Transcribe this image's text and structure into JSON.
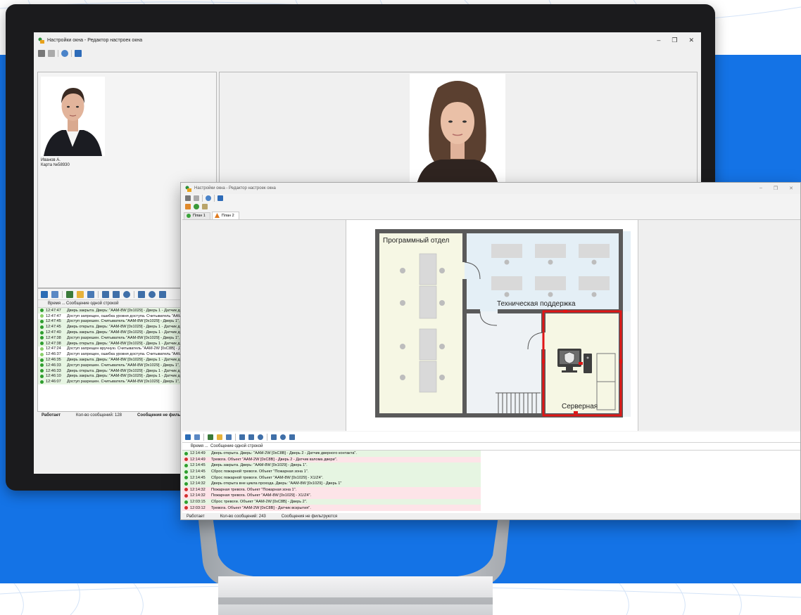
{
  "app": {
    "window_title": "Настройки окна - Редактор настроек окна",
    "minimize": "–",
    "restore": "❐",
    "close": "✕"
  },
  "person_left": {
    "name": "Иванов А.",
    "card": "Карта №58930"
  },
  "back_log": {
    "col_time": "Время ...",
    "col_message": "Сообщение одной строкой",
    "rows": [
      {
        "time": "12:47:47",
        "text": "Дверь закрыта. Дверь: \"AAM-8W [0x1029] - Дверь 1 - Датчик две",
        "status": "green"
      },
      {
        "time": "12:47:47",
        "text": "Доступ запрещен, ошибка уровня доступа. Считыватель \"AAM",
        "status": "light"
      },
      {
        "time": "12:47:45",
        "text": "Доступ разрешен. Считыватель \"AAM-8W [0x1029] - Дверь 1\", к",
        "status": "green"
      },
      {
        "time": "12:47:45",
        "text": "Дверь открыта. Дверь: \"AAM-8W [0x1029] - Дверь 1 - Датчик две",
        "status": "green"
      },
      {
        "time": "12:47:40",
        "text": "Дверь закрыта. Дверь: \"AAM-8W [0x1029] - Дверь 1 - Датчик две",
        "status": "green"
      },
      {
        "time": "12:47:38",
        "text": "Доступ разрешен. Считыватель \"AAM-8W [0x1029] - Дверь 1\", к",
        "status": "green"
      },
      {
        "time": "12:47:38",
        "text": "Дверь открыта. Дверь: \"AAM-8W [0x1029] - Дверь 1 - Датчик две",
        "status": "green"
      },
      {
        "time": "12:47:24",
        "text": "Доступ запрещен вручную. Считыватель \"AAM-2W [0xC8B] - Д",
        "status": "light"
      },
      {
        "time": "12:46:37",
        "text": "Доступ запрещен, ошибка уровня доступа. Считыватель \"AAM",
        "status": "light"
      },
      {
        "time": "12:46:35",
        "text": "Дверь закрыта. Дверь: \"AAM-8W [0x1029] - Дверь 1 - Датчик две",
        "status": "green"
      },
      {
        "time": "12:46:33",
        "text": "Доступ разрешен. Считыватель \"AAM-8W [0x1029] - Дверь 1\", к",
        "status": "green"
      },
      {
        "time": "12:46:33",
        "text": "Дверь открыта. Дверь: \"AAM-8W [0x1029] - Дверь 1 - Датчик две",
        "status": "green"
      },
      {
        "time": "12:46:10",
        "text": "Дверь закрыта. Дверь: \"AAM-8W [0x1029] - Дверь 1 - Датчик две",
        "status": "green"
      },
      {
        "time": "12:46:07",
        "text": "Доступ разрешен. Считыватель \"AAM-8W [0x1029] - Дверь 1\", к",
        "status": "green"
      }
    ],
    "status_working": "Работает",
    "status_count": "Кол-во сообщений: 128",
    "status_filter": "Сообщения не фильтруются"
  },
  "front": {
    "tabs": [
      "План 1",
      "План 2"
    ],
    "rooms": {
      "dev": "Программный отдел",
      "support": "Техническая поддержка",
      "server": "Серверная"
    },
    "log": {
      "col_time": "Время ...",
      "col_message": "Сообщение одной строкой",
      "rows": [
        {
          "time": "12:14:49",
          "text": "Дверь открыта. Дверь: \"AAM-2W [0xC8B] - Дверь 2 - Датчик дверного контакта\".",
          "status": "green"
        },
        {
          "time": "12:14:49",
          "text": "Тревога. Объект \"AAM-2W [0xC8B] - Дверь 2 - Датчик взлома двери\".",
          "status": "red"
        },
        {
          "time": "12:14:45",
          "text": "Дверь закрыта. Дверь: \"AAM-8W [0x1029] - Дверь 1\".",
          "status": "green"
        },
        {
          "time": "12:14:45",
          "text": "Сброс пожарной тревоги. Объект \"Пожарная зона 1\".",
          "status": "green"
        },
        {
          "time": "12:14:45",
          "text": "Сброс пожарной тревоги. Объект \"AAM-8W [0x1029] - X1/Z4\".",
          "status": "green"
        },
        {
          "time": "12:14:32",
          "text": "Дверь открыта вне цикла прохода. Дверь: \"AAM-8W [0x1029] - Дверь 1\"",
          "status": "green"
        },
        {
          "time": "12:14:32",
          "text": "Пожарная тревога. Объект \"Пожарная зона 1\".",
          "status": "red"
        },
        {
          "time": "12:14:32",
          "text": "Пожарная тревога. Объект \"AAM-8W [0x1029] - X1/Z4\".",
          "status": "red"
        },
        {
          "time": "12:03:15",
          "text": "Сброс тревоги. Объект \"AAM-2W [0xC8B] - Дверь 2\".",
          "status": "green"
        },
        {
          "time": "12:03:12",
          "text": "Тревога. Объект \"AAM-2W [0xC8B] - Датчик вскрытия\".",
          "status": "red"
        }
      ],
      "status_working": "Работает",
      "status_count": "Кол-во сообщений: 243",
      "status_filter": "Сообщения не фильтруются"
    }
  },
  "colors": {
    "background_blue": "#1473e6",
    "row_green": "#e6f5e2",
    "row_red": "#fde4e8",
    "dot_green": "#2e9e2e",
    "dot_red": "#d32f2f",
    "server_border": "#e01616",
    "room_yellow": "#f6f7e4",
    "room_blue": "#e4eff6"
  }
}
